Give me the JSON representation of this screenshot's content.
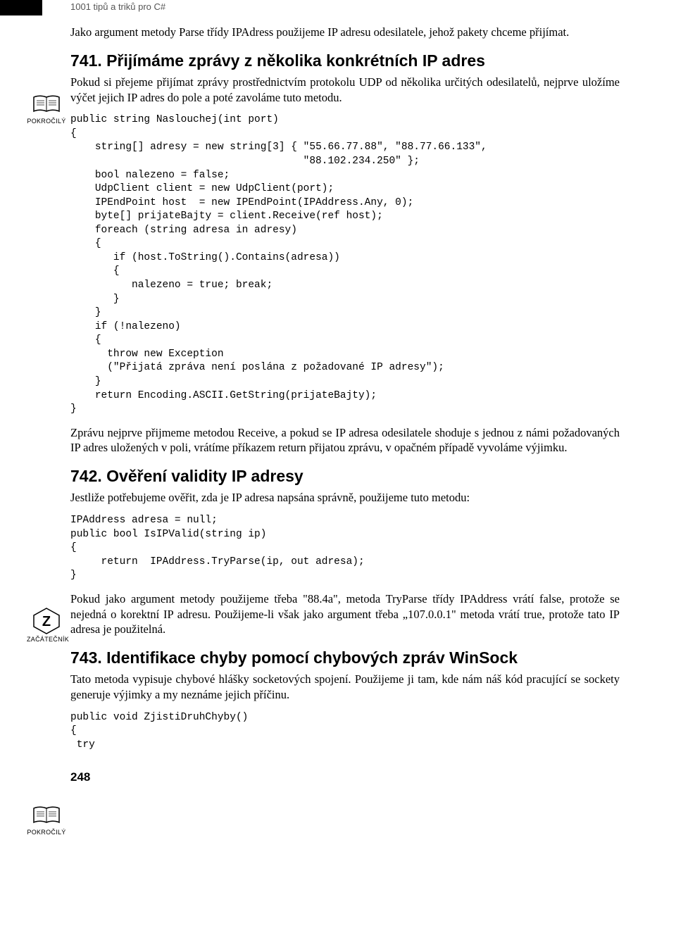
{
  "running_head": "1001 tipů a triků pro C#",
  "intro_para": "Jako argument metody Parse třídy IPAdress použijeme IP adresu odesilatele, jehož pakety chceme přijímat.",
  "icon_labels": {
    "pokrocily": "POKROČILÝ",
    "zacatecnik": "ZAČÁTEČNÍK"
  },
  "sec741": {
    "heading": "741. Přijímáme zprávy z několika konkrétních IP adres",
    "p1": "Pokud si přejeme přijímat zprávy prostřednictvím protokolu UDP od několika určitých odesilatelů, nejprve uložíme výčet jejich IP adres do pole a poté zavoláme tuto metodu.",
    "code": "public string Naslouchej(int port)\n{\n    string[] adresy = new string[3] { \"55.66.77.88\", \"88.77.66.133\",\n                                      \"88.102.234.250\" };\n    bool nalezeno = false;\n    UdpClient client = new UdpClient(port);\n    IPEndPoint host  = new IPEndPoint(IPAddress.Any, 0);\n    byte[] prijateBajty = client.Receive(ref host);\n    foreach (string adresa in adresy)\n    {\n       if (host.ToString().Contains(adresa))\n       {\n          nalezeno = true; break;\n       }\n    }\n    if (!nalezeno)\n    {\n      throw new Exception\n      (\"Přijatá zpráva není poslána z požadované IP adresy\");\n    }\n    return Encoding.ASCII.GetString(prijateBajty);\n}",
    "p2": "Zprávu nejprve přijmeme metodou Receive, a pokud se IP adresa odesilatele shoduje s jednou z námi požadovaných IP adres uložených v poli, vrátíme příkazem return přijatou zprávu, v opačném případě vyvoláme výjimku."
  },
  "sec742": {
    "heading": "742. Ověření validity IP adresy",
    "p1": "Jestliže potřebujeme ověřit, zda je IP adresa napsána správně, použijeme tuto metodu:",
    "code": "IPAddress adresa = null;\npublic bool IsIPValid(string ip)\n{\n     return  IPAddress.TryParse(ip, out adresa);\n}",
    "p2": "Pokud jako argument metody použijeme třeba \"88.4a\", metoda TryParse třídy IPAddress vrátí false, protože se nejedná o korektní IP adresu. Použijeme-li však jako argument třeba „107.0.0.1\" metoda vrátí true, protože tato IP adresa je použitelná."
  },
  "sec743": {
    "heading": "743. Identifikace chyby pomocí chybových zpráv WinSock",
    "p1": "Tato metoda vypisuje chybové hlášky socketových spojení. Použijeme ji tam, kde nám náš kód pracující se sockety generuje výjimky a my neznáme jejich příčinu.",
    "code": "public void ZjistiDruhChyby()\n{\n try"
  },
  "page_number": "248"
}
